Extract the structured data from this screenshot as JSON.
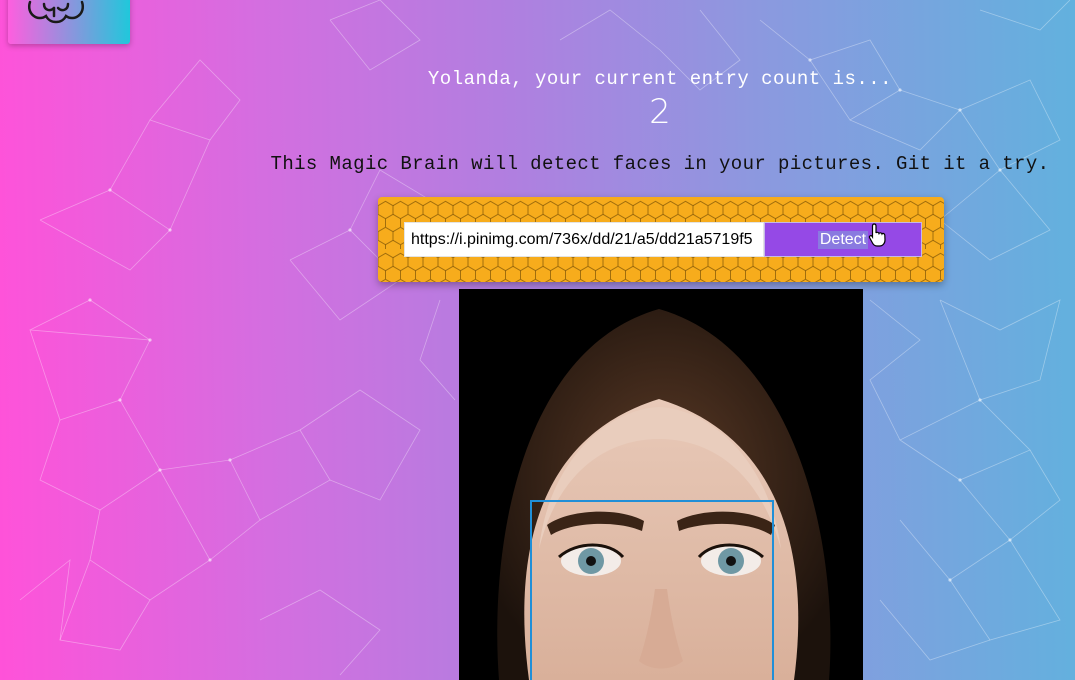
{
  "header": {
    "logo": {
      "icon": "brain-icon"
    }
  },
  "rank": {
    "greeting": "Yolanda, your current entry count is...",
    "count": "2"
  },
  "intro": {
    "text": "This Magic Brain will detect faces in your pictures. Git it a try."
  },
  "form": {
    "url_value": "https://i.pinimg.com/736x/dd/21/a5/dd21a5719f5",
    "detect_label": "Detect"
  },
  "result": {
    "image_alt": "portrait-photo",
    "box_icon": "face-bounding-box"
  },
  "colors": {
    "gradient_left": "#ff52d9",
    "gradient_right": "#62b1de",
    "panel": "#f7ac1c",
    "button": "#9549e6",
    "face_box": "#1f8fd8"
  }
}
